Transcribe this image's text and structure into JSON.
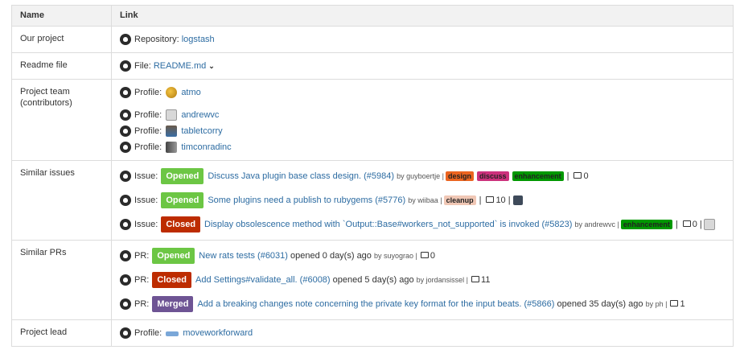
{
  "headers": {
    "name": "Name",
    "link": "Link"
  },
  "rows": {
    "project": {
      "name": "Our project",
      "prefix": "Repository:",
      "link": "logstash"
    },
    "readme": {
      "name": "Readme file",
      "prefix": "File:",
      "link": "README.md"
    },
    "team": {
      "name": "Project team (contributors)",
      "prefix": "Profile:",
      "members": [
        "atmo",
        "andrewvc",
        "tabletcorry",
        "timconradinc"
      ]
    },
    "issues": {
      "name": "Similar issues",
      "prefix": "Issue:",
      "items": [
        {
          "state": "Opened",
          "title": "Discuss Java plugin base class design. (#5984)",
          "by": "by guyboertje |",
          "labels": [
            "design",
            "discuss",
            "enhancement"
          ],
          "after": "|",
          "comments": "0"
        },
        {
          "state": "Opened",
          "title": "Some plugins need a publish to rubygems (#5776)",
          "by": "by wiibaa |",
          "labels": [
            "cleanup"
          ],
          "after": "|",
          "comments": "10 |"
        },
        {
          "state": "Closed",
          "title": "Display obsolescence method with `Output::Base#workers_not_supported` is invoked (#5823)",
          "by": "by andrewvc |",
          "labels": [
            "enhancement"
          ],
          "after": "|",
          "comments": "0 |"
        }
      ]
    },
    "prs": {
      "name": "Similar PRs",
      "prefix": "PR:",
      "items": [
        {
          "state": "Opened",
          "title": "New rats tests (#6031)",
          "opened": "opened 0 day(s) ago",
          "by": "by suyograo |",
          "comments": "0"
        },
        {
          "state": "Closed",
          "title": "Add Settings#validate_all. (#6008)",
          "opened": "opened 5 day(s) ago",
          "by": "by jordansissel |",
          "comments": "11"
        },
        {
          "state": "Merged",
          "title": "Add a breaking changes note concerning the private key format for the input beats. (#5866)",
          "opened": "opened 35 day(s) ago",
          "by": "by ph |",
          "comments": "1"
        }
      ]
    },
    "lead": {
      "name": "Project lead",
      "prefix": "Profile:",
      "link": "moveworkforward"
    }
  },
  "colors": {
    "opened": "#6cc644",
    "closed": "#bd2c00",
    "merged": "#6e5494",
    "link": "#2d6ca2"
  },
  "icons": {
    "repo": "github-octocat-icon",
    "comment": "comment-icon",
    "dropdown": "chevron-down-icon"
  }
}
